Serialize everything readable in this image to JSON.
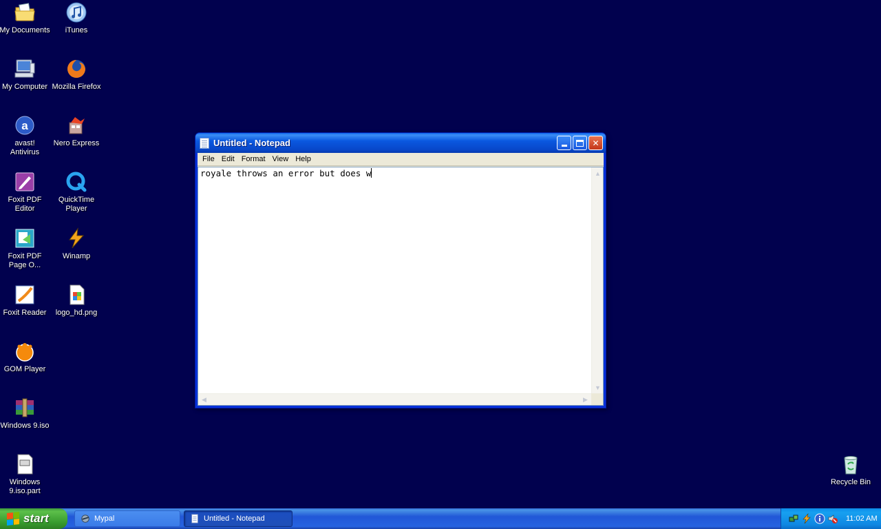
{
  "desktop": {
    "icons": [
      {
        "label": "My Documents",
        "icon": "folder-documents-icon"
      },
      {
        "label": "iTunes",
        "icon": "itunes-icon"
      },
      {
        "label": "My Computer",
        "icon": "computer-icon"
      },
      {
        "label": "Mozilla Firefox",
        "icon": "firefox-icon"
      },
      {
        "label": "avast!\nAntivirus",
        "icon": "avast-icon"
      },
      {
        "label": "Nero Express",
        "icon": "nero-icon"
      },
      {
        "label": "Foxit PDF\nEditor",
        "icon": "foxit-editor-icon"
      },
      {
        "label": "QuickTime\nPlayer",
        "icon": "quicktime-icon"
      },
      {
        "label": "Foxit PDF\nPage O...",
        "icon": "foxit-page-icon"
      },
      {
        "label": "Winamp",
        "icon": "winamp-icon"
      },
      {
        "label": "Foxit Reader",
        "icon": "foxit-reader-icon"
      },
      {
        "label": "logo_hd.png",
        "icon": "png-file-icon"
      },
      {
        "label": "GOM Player",
        "icon": "gom-player-icon"
      },
      {
        "label": "Windows 9.iso",
        "icon": "winrar-archive-icon"
      },
      {
        "label": "Windows\n9.iso.part",
        "icon": "part-file-icon"
      },
      {
        "label": "Recycle Bin",
        "icon": "recycle-bin-icon"
      }
    ]
  },
  "notepad": {
    "title": "Untitled - Notepad",
    "menu": [
      "File",
      "Edit",
      "Format",
      "View",
      "Help"
    ],
    "content": "royale throws an error but does w"
  },
  "taskbar": {
    "start_label": "start",
    "tasks": [
      {
        "label": "Mypal",
        "active": false
      },
      {
        "label": "Untitled - Notepad",
        "active": true
      }
    ],
    "clock": "11:02 AM"
  },
  "colors": {
    "desktop_bg": "#01014e",
    "title_blue": "#0a58e0",
    "start_green": "#379a2e"
  }
}
